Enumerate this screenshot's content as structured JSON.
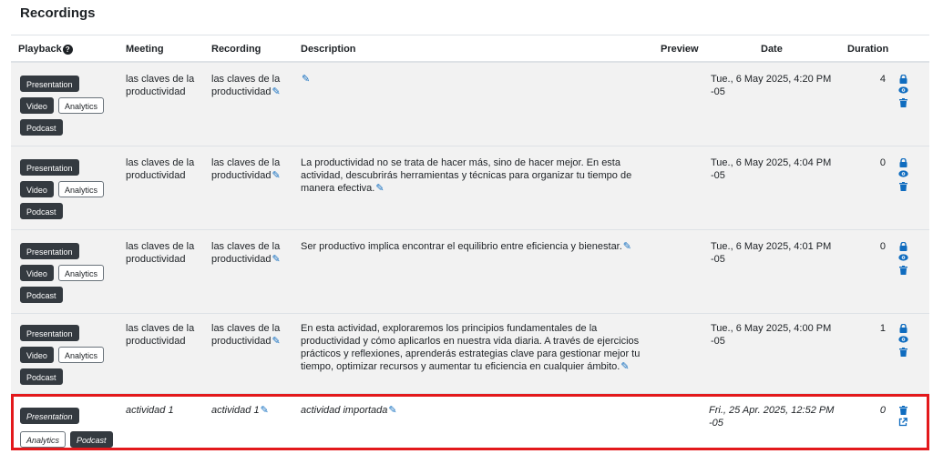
{
  "page_title": "Recordings",
  "columns": {
    "playback": "Playback",
    "meeting": "Meeting",
    "recording": "Recording",
    "description": "Description",
    "preview": "Preview",
    "date": "Date",
    "duration": "Duration"
  },
  "help_glyph": "?",
  "buttons": {
    "presentation": "Presentation",
    "video": "Video",
    "analytics": "Analytics",
    "podcast": "Podcast"
  },
  "colors": {
    "dark_button": "#343a40",
    "link_blue": "#0f6cbf",
    "highlight_border": "#e3191c",
    "row_bg": "#f2f2f2"
  },
  "rows": [
    {
      "meeting": "las claves de la productividad",
      "recording": "las claves de la productividad",
      "description": "",
      "date": "Tue., 6 May 2025, 4:20 PM -05",
      "duration": "4",
      "action_icons": [
        "lock-icon",
        "eye-icon",
        "trash-icon"
      ]
    },
    {
      "meeting": "las claves de la productividad",
      "recording": "las claves de la productividad",
      "description": "La productividad no se trata de hacer más, sino de hacer mejor. En esta actividad, descubrirás herramientas y técnicas para organizar tu tiempo de manera efectiva.",
      "date": "Tue., 6 May 2025, 4:04 PM -05",
      "duration": "0",
      "action_icons": [
        "lock-icon",
        "eye-icon",
        "trash-icon"
      ]
    },
    {
      "meeting": "las claves de la productividad",
      "recording": "las claves de la productividad",
      "description": "Ser productivo implica encontrar el equilibrio entre eficiencia y bienestar.",
      "date": "Tue., 6 May 2025, 4:01 PM -05",
      "duration": "0",
      "action_icons": [
        "lock-icon",
        "eye-icon",
        "trash-icon"
      ]
    },
    {
      "meeting": "las claves de la productividad",
      "recording": "las claves de la productividad",
      "description": "En esta actividad, exploraremos los principios fundamentales de la productividad y cómo aplicarlos en nuestra vida diaria. A través de ejercicios prácticos y reflexiones, aprenderás estrategias clave para gestionar mejor tu tiempo, optimizar recursos y aumentar tu eficiencia en cualquier ámbito.",
      "date": "Tue., 6 May 2025, 4:00 PM -05",
      "duration": "1",
      "action_icons": [
        "lock-icon",
        "eye-icon",
        "trash-icon"
      ]
    },
    {
      "meeting": "actividad 1",
      "recording": "actividad 1",
      "description": "actividad importada",
      "date": "Fri., 25 Apr. 2025, 12:52 PM -05",
      "duration": "0",
      "action_icons": [
        "trash-icon",
        "external-link-icon"
      ]
    }
  ]
}
